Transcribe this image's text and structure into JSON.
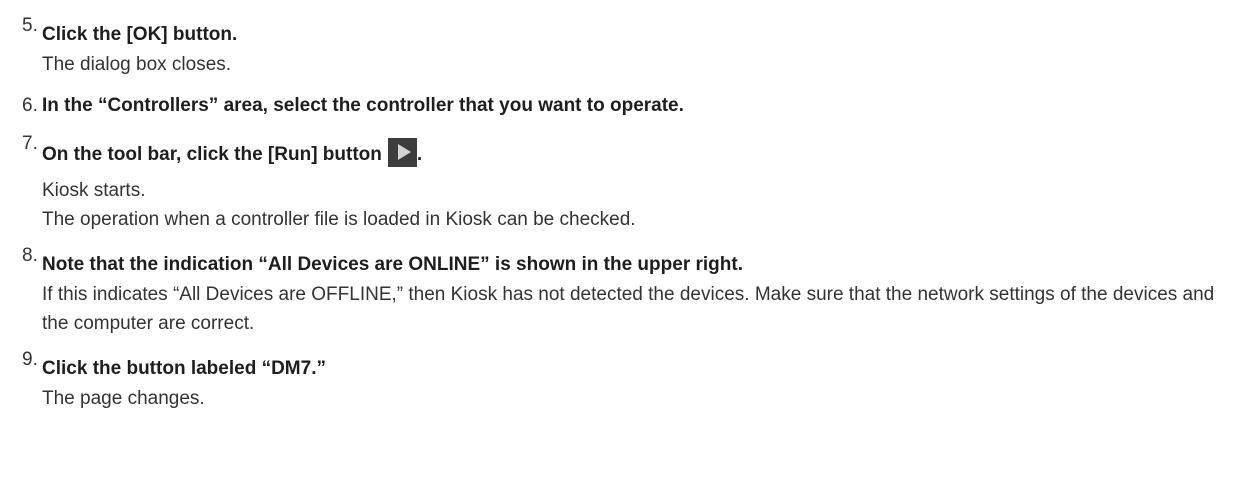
{
  "steps": [
    {
      "number": "5.",
      "title": "Click the [OK] button.",
      "desc": [
        "The dialog box closes."
      ]
    },
    {
      "number": "6.",
      "title": "In the “Controllers” area, select the controller that you want to operate.",
      "desc": []
    },
    {
      "number": "7.",
      "title": "On the tool bar, click the [Run] button",
      "title_suffix": ".",
      "icon": "run-play-icon",
      "desc": [
        "Kiosk starts.",
        "The operation when a controller file is loaded in Kiosk can be checked."
      ]
    },
    {
      "number": "8.",
      "title": "Note that the indication “All Devices are ONLINE” is shown in the upper right.",
      "desc": [
        "If this indicates “All Devices are OFFLINE,” then Kiosk has not detected the devices. Make sure that the network settings of the devices and the computer are correct."
      ]
    },
    {
      "number": "9.",
      "title": "Click the button labeled “DM7.”",
      "desc": [
        "The page changes."
      ]
    }
  ]
}
